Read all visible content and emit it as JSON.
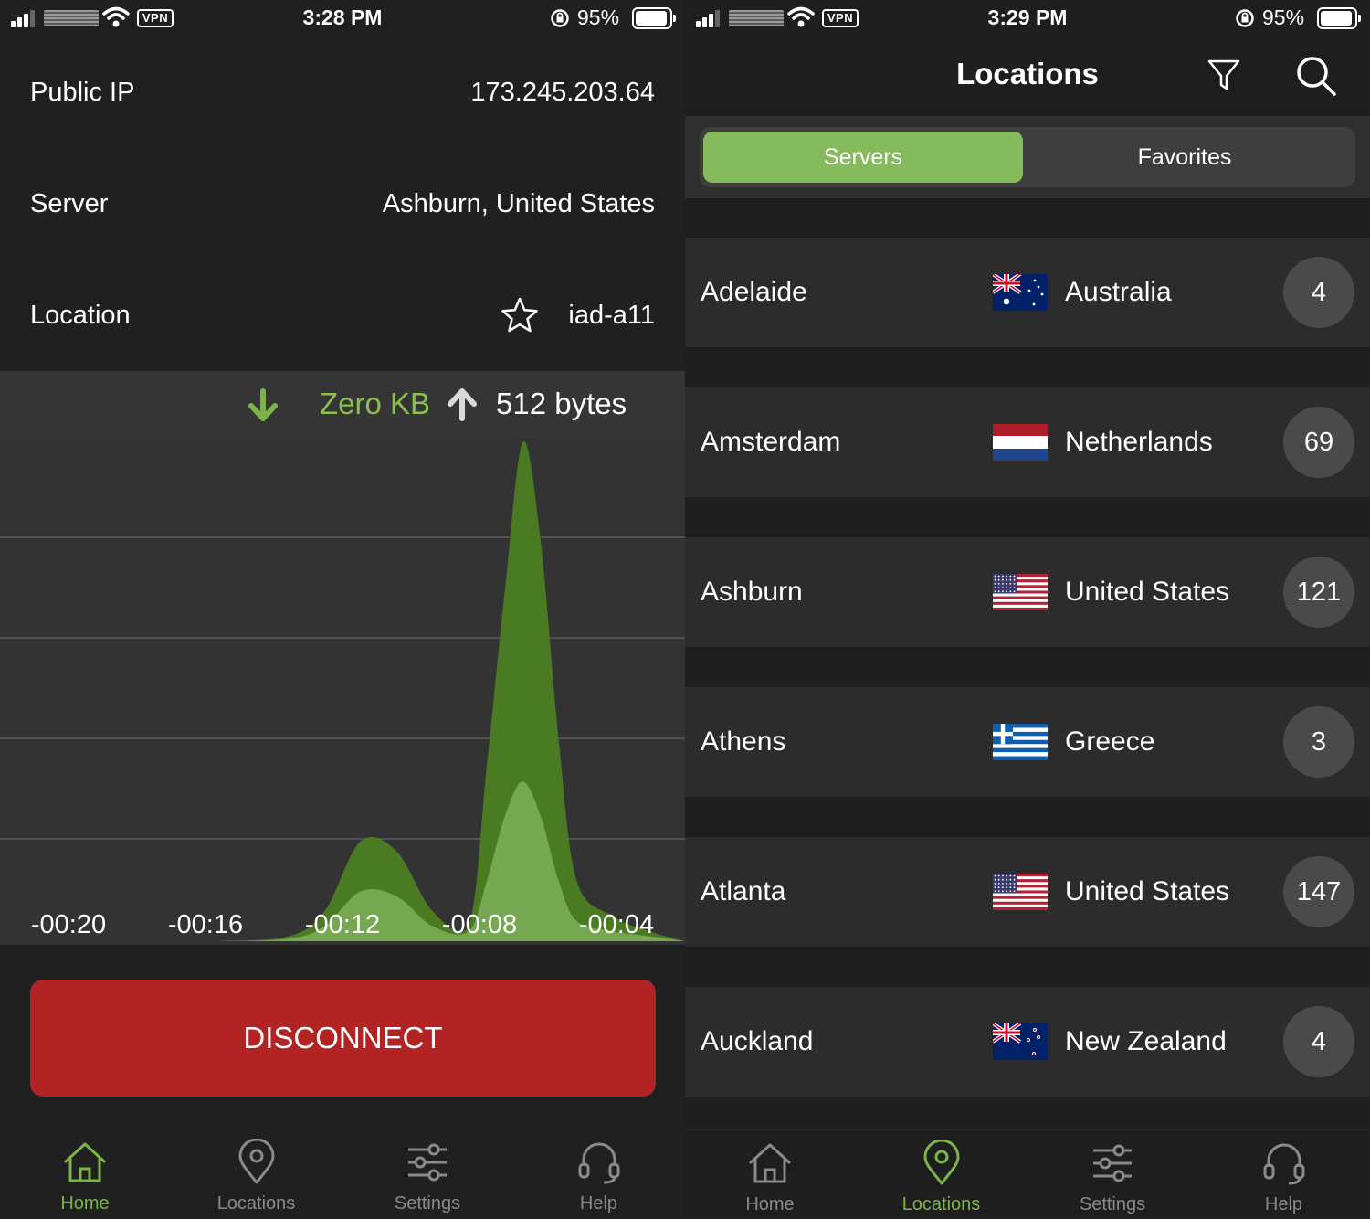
{
  "left": {
    "status_bar": {
      "time": "3:28 PM",
      "battery": "95%",
      "vpn_badge": "VPN"
    },
    "info": {
      "public_ip_label": "Public IP",
      "public_ip_value": "173.245.203.64",
      "server_label": "Server",
      "server_value": "Ashburn, United States",
      "location_label": "Location",
      "location_value": "iad-a11"
    },
    "traffic": {
      "download": "Zero KB",
      "upload": "512 bytes"
    },
    "chart_data": {
      "type": "area",
      "x": [
        -22,
        -20,
        -18,
        -16,
        -14,
        -13,
        -12,
        -11,
        -10,
        -9,
        -8.5,
        -8,
        -7.5,
        -7,
        -6.5,
        -6,
        -5,
        -4,
        -3
      ],
      "x_tick_labels": [
        "-00:20",
        "-00:16",
        "-00:12",
        "-00:08",
        "-00:04"
      ],
      "series": [
        {
          "values": [
            0,
            0,
            0,
            0,
            1,
            6,
            20,
            18,
            6,
            3,
            35,
            70,
            100,
            80,
            40,
            12,
            5,
            2,
            0
          ],
          "color": "#4a7a22"
        },
        {
          "values": [
            0,
            0,
            0,
            0,
            0.5,
            3,
            10,
            9,
            3,
            2,
            12,
            25,
            32,
            25,
            12,
            4,
            2,
            1,
            0
          ],
          "color": "#76a852"
        }
      ],
      "grid": true
    },
    "disconnect_label": "DISCONNECT",
    "tabs": [
      {
        "label": "Home",
        "icon": "home-icon",
        "active": true
      },
      {
        "label": "Locations",
        "icon": "location-pin-icon",
        "active": false
      },
      {
        "label": "Settings",
        "icon": "sliders-icon",
        "active": false
      },
      {
        "label": "Help",
        "icon": "headset-icon",
        "active": false
      }
    ]
  },
  "right": {
    "status_bar": {
      "time": "3:29 PM",
      "battery": "95%",
      "vpn_badge": "VPN"
    },
    "title": "Locations",
    "segments": {
      "servers": "Servers",
      "favorites": "Favorites"
    },
    "locations": [
      {
        "city": "Adelaide",
        "country": "Australia",
        "count": "4",
        "flag": "australia-flag"
      },
      {
        "city": "Amsterdam",
        "country": "Netherlands",
        "count": "69",
        "flag": "netherlands-flag"
      },
      {
        "city": "Ashburn",
        "country": "United States",
        "count": "121",
        "flag": "usa-flag"
      },
      {
        "city": "Athens",
        "country": "Greece",
        "count": "3",
        "flag": "greece-flag"
      },
      {
        "city": "Atlanta",
        "country": "United States",
        "count": "147",
        "flag": "usa-flag"
      },
      {
        "city": "Auckland",
        "country": "New Zealand",
        "count": "4",
        "flag": "new-zealand-flag"
      }
    ],
    "tabs": [
      {
        "label": "Home",
        "icon": "home-icon",
        "active": false
      },
      {
        "label": "Locations",
        "icon": "location-pin-icon",
        "active": true
      },
      {
        "label": "Settings",
        "icon": "sliders-icon",
        "active": false
      },
      {
        "label": "Help",
        "icon": "headset-icon",
        "active": false
      }
    ]
  },
  "colors": {
    "accent_green": "#7db44a",
    "disconnect_red": "#b22424",
    "segment_green": "#85bb5c"
  }
}
